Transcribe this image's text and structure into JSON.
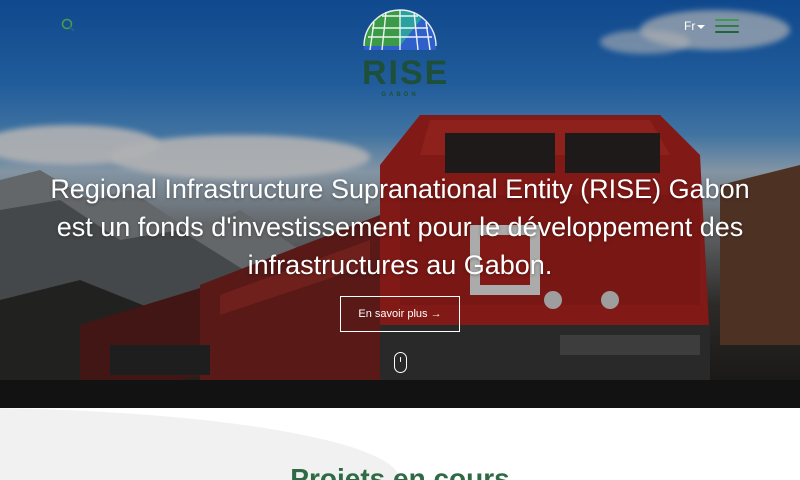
{
  "header": {
    "logo_text": "RISE",
    "logo_subtext": "GABON",
    "language": "Fr"
  },
  "hero": {
    "headline": "Regional Infrastructure Supranational Entity (RISE) Gabon est un fonds d'investissement pour le développement des infrastructures au Gabon.",
    "cta_label": "En savoir plus →"
  },
  "section": {
    "title": "Projets en cours"
  },
  "colors": {
    "brand_green": "#2e6b45",
    "logo_blue": "#3a6fd8",
    "logo_teal": "#2aa1a0"
  },
  "icons": [
    "search-icon",
    "menu-icon",
    "mouse-scroll-icon",
    "globe-logo-icon",
    "caret-down-icon"
  ]
}
